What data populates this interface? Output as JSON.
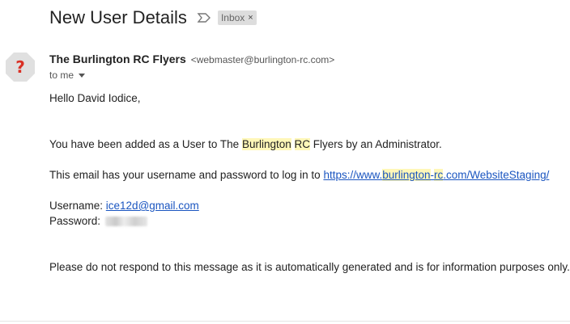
{
  "subject": "New User Details",
  "label": {
    "text": "Inbox",
    "close": "×"
  },
  "sender": {
    "name": "The Burlington RC Flyers",
    "email": "<webmaster@burlington-rc.com>"
  },
  "recipient": "to me",
  "body": {
    "greeting": "Hello David Iodice,",
    "line1_prefix": "You have been added as a User to The ",
    "line1_hl1": "Burlington",
    "line1_space": " ",
    "line1_hl2": "RC",
    "line1_suffix": " Flyers by an Administrator.",
    "line2_prefix": "This email has your username and password to log in to ",
    "link_part1": "https://www.",
    "link_hl1": "burlington",
    "link_dash": "-",
    "link_hl2": "rc",
    "link_part2": ".com/WebsiteStaging/",
    "username_label": "Username: ",
    "username_value": "ice12d@gmail.com",
    "password_label": "Password:",
    "footer": "Please do not respond to this message as it is automatically generated and is for information purposes only."
  },
  "colors": {
    "highlight": "#fff7b8",
    "link": "#1a55c0",
    "avatar_bg": "#e0e0e0",
    "avatar_mark": "#d93025"
  }
}
